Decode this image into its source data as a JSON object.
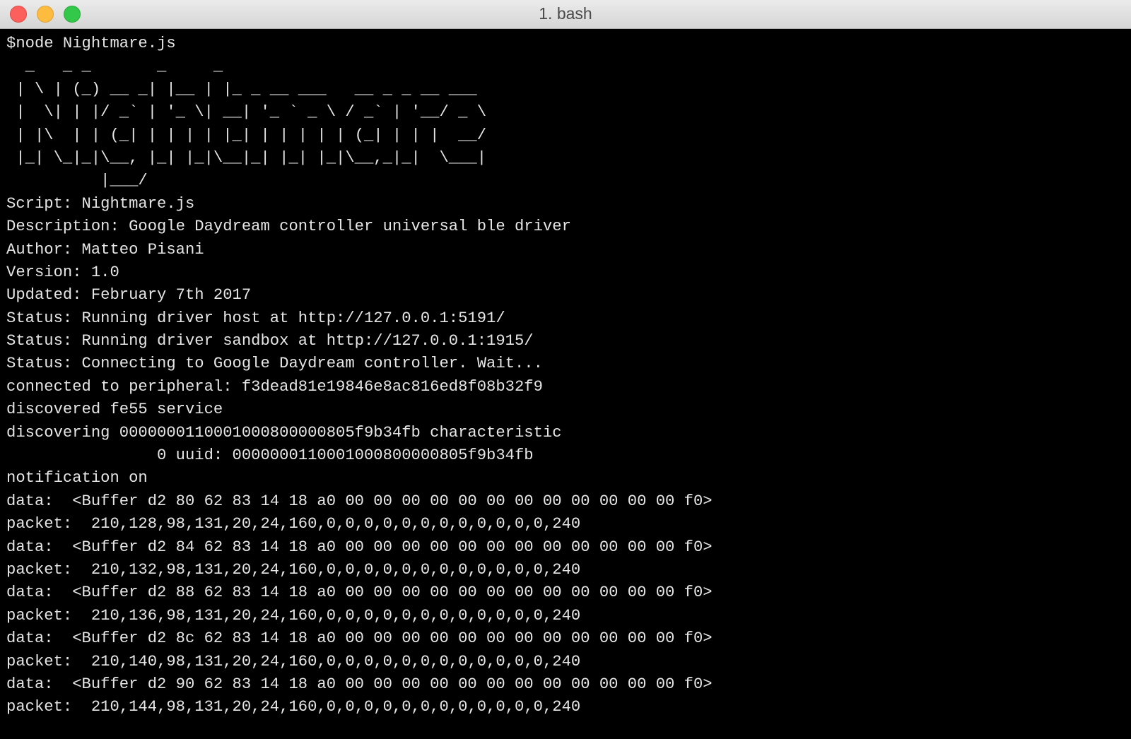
{
  "window": {
    "title": "1. bash"
  },
  "terminal": {
    "lines": [
      "$node Nightmare.js",
      "  _   _ _       _     _",
      " | \\ | (_) __ _| |__ | |_ _ __ ___   __ _ _ __ ___",
      " |  \\| | |/ _` | '_ \\| __| '_ ` _ \\ / _` | '__/ _ \\",
      " | |\\  | | (_| | | | | |_| | | | | | (_| | | |  __/",
      " |_| \\_|_|\\__, |_| |_|\\__|_| |_| |_|\\__,_|_|  \\___|",
      "          |___/",
      "Script: Nightmare.js",
      "Description: Google Daydream controller universal ble driver",
      "Author: Matteo Pisani",
      "Version: 1.0",
      "Updated: February 7th 2017",
      "Status: Running driver host at http://127.0.0.1:5191/",
      "Status: Running driver sandbox at http://127.0.0.1:1915/",
      "Status: Connecting to Google Daydream controller. Wait...",
      "connected to peripheral: f3dead81e19846e8ac816ed8f08b32f9",
      "discovered fe55 service",
      "discovering 0000000110001000800000805f9b34fb characteristic",
      "                0 uuid: 0000000110001000800000805f9b34fb",
      "notification on",
      "data:  <Buffer d2 80 62 83 14 18 a0 00 00 00 00 00 00 00 00 00 00 00 00 f0>",
      "packet:  210,128,98,131,20,24,160,0,0,0,0,0,0,0,0,0,0,0,0,240",
      "data:  <Buffer d2 84 62 83 14 18 a0 00 00 00 00 00 00 00 00 00 00 00 00 f0>",
      "packet:  210,132,98,131,20,24,160,0,0,0,0,0,0,0,0,0,0,0,0,240",
      "data:  <Buffer d2 88 62 83 14 18 a0 00 00 00 00 00 00 00 00 00 00 00 00 f0>",
      "packet:  210,136,98,131,20,24,160,0,0,0,0,0,0,0,0,0,0,0,0,240",
      "data:  <Buffer d2 8c 62 83 14 18 a0 00 00 00 00 00 00 00 00 00 00 00 00 f0>",
      "packet:  210,140,98,131,20,24,160,0,0,0,0,0,0,0,0,0,0,0,0,240",
      "data:  <Buffer d2 90 62 83 14 18 a0 00 00 00 00 00 00 00 00 00 00 00 00 f0>",
      "packet:  210,144,98,131,20,24,160,0,0,0,0,0,0,0,0,0,0,0,0,240"
    ]
  }
}
